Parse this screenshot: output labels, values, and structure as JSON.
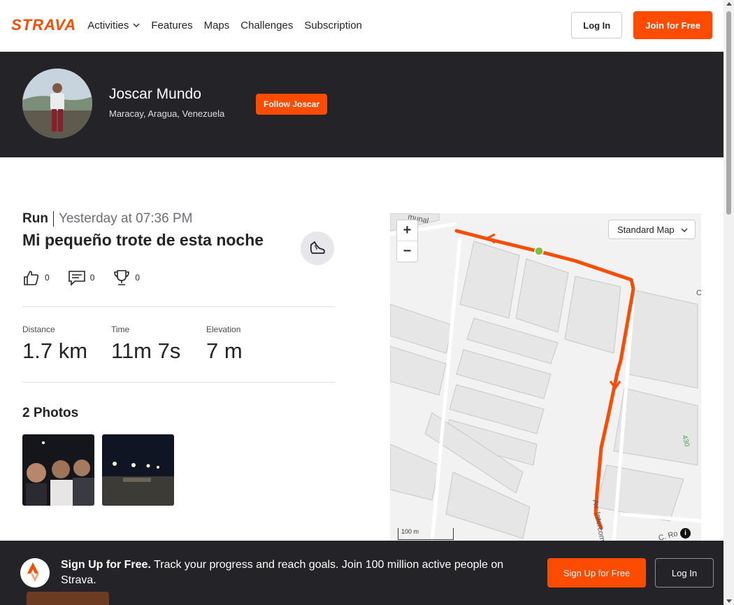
{
  "nav": {
    "logo": "STRAVA",
    "items": [
      "Activities",
      "Features",
      "Maps",
      "Challenges",
      "Subscription"
    ],
    "login": "Log In",
    "join": "Join for Free"
  },
  "athlete": {
    "name": "Joscar Mundo",
    "location": "Maracay, Aragua, Venezuela",
    "follow": "Follow Joscar"
  },
  "activity": {
    "type": "Run",
    "time": "Yesterday at 07:36 PM",
    "title": "Mi pequeño trote de esta noche",
    "kudos": "0",
    "comments": "0",
    "achievements": "0",
    "stats": [
      {
        "label": "Distance",
        "value": "1.7 km"
      },
      {
        "label": "Time",
        "value": "11m 7s"
      },
      {
        "label": "Elevation",
        "value": "7 m"
      }
    ],
    "photos_heading": "2 Photos"
  },
  "map": {
    "style": "Standard Map",
    "scale": "100 m",
    "zoom_in": "+",
    "zoom_out": "−",
    "info": "i",
    "street_labels": [
      "munal",
      "Av. Intercom",
      "C. Ro",
      "430",
      "C"
    ],
    "route_color": "#fc4c02"
  },
  "banner": {
    "headline": "Sign Up for Free.",
    "text": "Track your progress and reach goals. Join 100 million active people on Strava.",
    "signup": "Sign Up for Free",
    "login": "Log In"
  },
  "colors": {
    "brand": "#fc4c02",
    "dark": "#242428"
  }
}
